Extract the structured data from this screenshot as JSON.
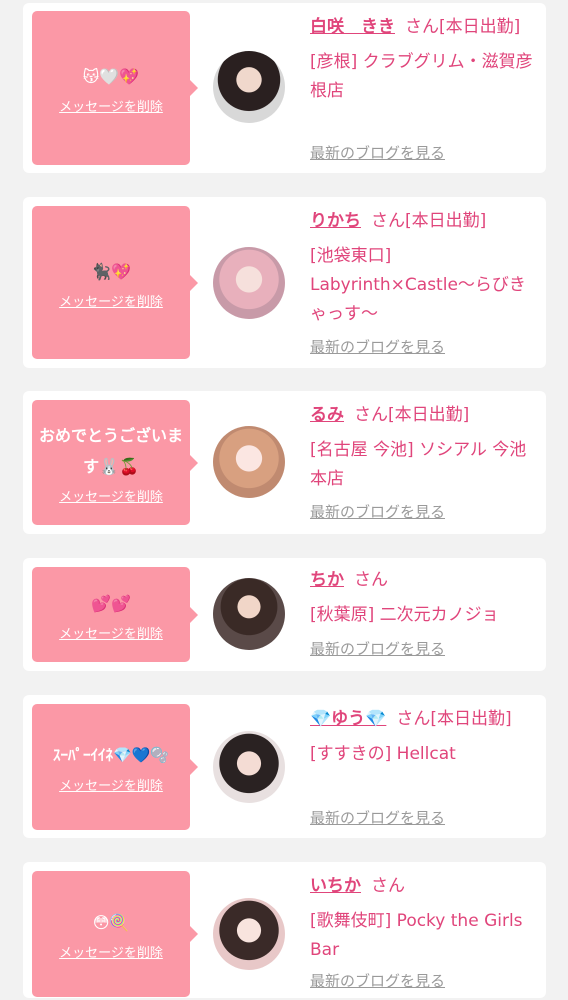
{
  "cards": [
    {
      "message": "😽🤍💖",
      "delete_label": "メッセージを削除",
      "name": "白咲　きき",
      "san": "さん[本日出勤]",
      "shop": "[彦根] クラブグリム・滋賀彦根店",
      "blog_label": "最新のブログを見る"
    },
    {
      "message": "🐈‍⬛💖",
      "delete_label": "メッセージを削除",
      "name": "りかち",
      "san": "さん[本日出勤]",
      "shop": "[池袋東口] Labyrinth×Castle〜らびきゃっす〜",
      "blog_label": "最新のブログを見る"
    },
    {
      "message": "おめでとうございます🐰🍒",
      "delete_label": "メッセージを削除",
      "name": "るみ",
      "san": "さん[本日出勤]",
      "shop": "[名古屋 今池] ソシアル 今池本店",
      "blog_label": "最新のブログを見る"
    },
    {
      "message": "💕💕",
      "delete_label": "メッセージを削除",
      "name": "ちか",
      "san": "さん",
      "shop": "[秋葉原] 二次元カノジョ",
      "blog_label": "最新のブログを見る"
    },
    {
      "message": "ｽｰﾊﾟｰｲｲﾈ💎💙🫧",
      "delete_label": "メッセージを削除",
      "name": "💎ゆう💎",
      "san": "さん[本日出勤]",
      "shop": "[すすきの] Hellcat",
      "blog_label": "最新のブログを見る"
    },
    {
      "message": "😳🍭",
      "delete_label": "メッセージを削除",
      "name": "いちか",
      "san": "さん",
      "shop": "[歌舞伎町] Pocky the Girls Bar",
      "blog_label": "最新のブログを見る"
    }
  ],
  "colors": {
    "accent": "#e0457b",
    "bubble": "#fb98a6",
    "link_gray": "#9a9a9a",
    "background": "#f2f2f2"
  }
}
